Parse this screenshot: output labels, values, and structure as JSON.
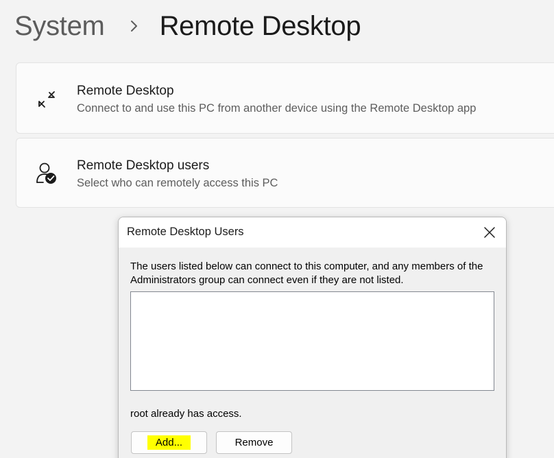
{
  "breadcrumb": {
    "parent": "System",
    "current": "Remote Desktop"
  },
  "cards": [
    {
      "icon": "remote-desktop-icon",
      "title": "Remote Desktop",
      "description": "Connect to and use this PC from another device using the Remote Desktop app"
    },
    {
      "icon": "user-check-icon",
      "title": "Remote Desktop users",
      "description": "Select who can remotely access this PC"
    }
  ],
  "dialog": {
    "title": "Remote Desktop Users",
    "description": "The users listed below can connect to this computer, and any members of the Administrators group can connect even if they are not listed.",
    "users": [],
    "status": "root already has access.",
    "add_label": "Add...",
    "remove_label": "Remove"
  },
  "colors": {
    "highlight": "#ffff00",
    "background": "#f3f3f3",
    "card": "#fbfbfb"
  }
}
